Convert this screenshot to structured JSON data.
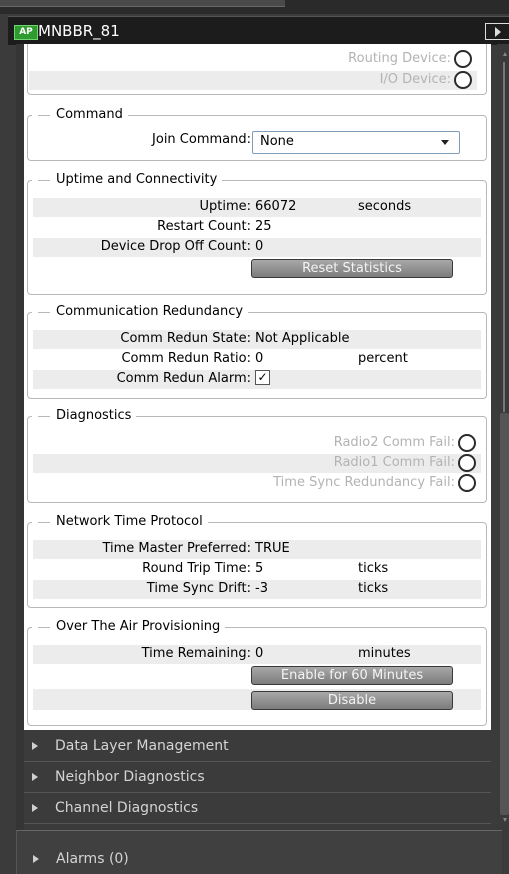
{
  "header": {
    "badge": "AP",
    "title": "MNBBR_81"
  },
  "status_indicators": [
    {
      "label": "Routing Device:"
    },
    {
      "label": "I/O Device:"
    }
  ],
  "command": {
    "title": "Command",
    "join_label": "Join Command:",
    "join_value": "None"
  },
  "uptime": {
    "title": "Uptime and Connectivity",
    "rows": [
      {
        "label": "Uptime:",
        "value": "66072",
        "unit": "seconds"
      },
      {
        "label": "Restart Count:",
        "value": "25",
        "unit": ""
      },
      {
        "label": "Device Drop Off Count:",
        "value": "0",
        "unit": ""
      }
    ],
    "reset_button": "Reset Statistics"
  },
  "comm_redundancy": {
    "title": "Communication Redundancy",
    "state_label": "Comm Redun State:",
    "state_value": "Not Applicable",
    "ratio_label": "Comm Redun Ratio:",
    "ratio_value": "0",
    "ratio_unit": "percent",
    "alarm_label": "Comm Redun Alarm:",
    "alarm_checked": "✓"
  },
  "diagnostics": {
    "title": "Diagnostics",
    "items": [
      {
        "label": "Radio2 Comm Fail:"
      },
      {
        "label": "Radio1 Comm Fail:"
      },
      {
        "label": "Time Sync Redundancy Fail:"
      }
    ]
  },
  "ntp": {
    "title": "Network Time Protocol",
    "rows": [
      {
        "label": "Time Master Preferred:",
        "value": "TRUE",
        "unit": ""
      },
      {
        "label": "Round Trip Time:",
        "value": "5",
        "unit": "ticks"
      },
      {
        "label": "Time Sync Drift:",
        "value": "-3",
        "unit": "ticks"
      }
    ]
  },
  "ota": {
    "title": "Over The Air Provisioning",
    "remaining_label": "Time Remaining:",
    "remaining_value": "0",
    "remaining_unit": "minutes",
    "enable_button": "Enable for 60 Minutes",
    "disable_button": "Disable"
  },
  "sections": [
    {
      "label": "Data Layer Management"
    },
    {
      "label": "Neighbor Diagnostics"
    },
    {
      "label": "Channel Diagnostics"
    }
  ],
  "alarms": {
    "label": "Alarms (0)"
  }
}
